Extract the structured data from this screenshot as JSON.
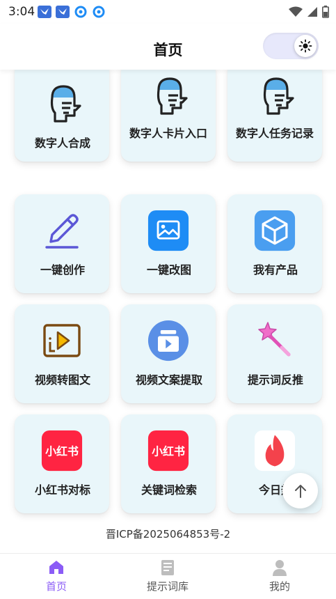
{
  "status_bar": {
    "time": "3:04"
  },
  "header": {
    "title": "首页"
  },
  "grid": {
    "items": [
      {
        "label": "数字人合成",
        "icon": "digital-human-icon"
      },
      {
        "label": "数字人卡片入口",
        "icon": "digital-human-icon"
      },
      {
        "label": "数字人任务记录",
        "icon": "digital-human-icon"
      },
      {
        "label": "一键创作",
        "icon": "pencil-icon"
      },
      {
        "label": "一键改图",
        "icon": "image-edit-icon"
      },
      {
        "label": "我有产品",
        "icon": "product-box-icon"
      },
      {
        "label": "视频转图文",
        "icon": "video-to-text-icon"
      },
      {
        "label": "视频文案提取",
        "icon": "video-copy-extract-icon"
      },
      {
        "label": "提示词反推",
        "icon": "magic-wand-icon"
      },
      {
        "label": "小红书对标",
        "icon": "xiaohongshu-icon",
        "badge": "小红书"
      },
      {
        "label": "关键词检索",
        "icon": "xiaohongshu-icon",
        "badge": "小红书"
      },
      {
        "label": "今日热",
        "icon": "flame-icon"
      }
    ]
  },
  "footer": {
    "icp": "晋ICP备2025064853号-2"
  },
  "bottom_nav": {
    "items": [
      {
        "label": "首页",
        "icon": "home-icon",
        "active": true
      },
      {
        "label": "提示词库",
        "icon": "document-icon",
        "active": false
      },
      {
        "label": "我的",
        "icon": "profile-icon",
        "active": false
      }
    ]
  },
  "colors": {
    "accent": "#8b5cf6",
    "card_bg": "#e9f6fa",
    "head_blue": "#5aaee8",
    "app_blue": "#1e8cf5",
    "xhs_red": "#ff2442"
  }
}
